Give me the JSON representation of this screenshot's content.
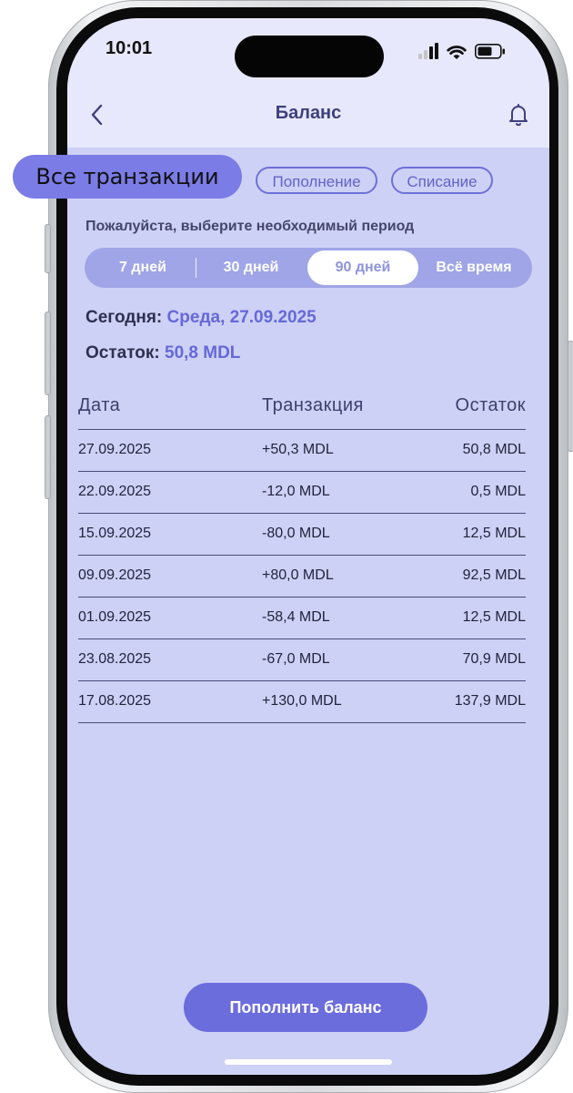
{
  "status_bar": {
    "time": "10:01"
  },
  "header": {
    "title": "Баланс"
  },
  "tooltip": {
    "label": "Все транзакции"
  },
  "filters": {
    "topup": "Пополнение",
    "debit": "Списание"
  },
  "period": {
    "prompt": "Пожалуйста, выберите необходимый период",
    "options": [
      "7 дней",
      "30 дней",
      "90 дней",
      "Всё время"
    ],
    "selected": "90 дней"
  },
  "summary": {
    "today_label": "Сегодня:",
    "today_value": "Среда, 27.09.2025",
    "balance_label": "Остаток:",
    "balance_value": "50,8 MDL"
  },
  "table": {
    "headers": [
      "Дата",
      "Транзакция",
      "Остаток"
    ],
    "rows": [
      [
        "27.09.2025",
        "+50,3 MDL",
        "50,8 MDL"
      ],
      [
        "22.09.2025",
        "-12,0 MDL",
        "0,5 MDL"
      ],
      [
        "15.09.2025",
        "-80,0 MDL",
        "12,5 MDL"
      ],
      [
        "09.09.2025",
        "+80,0 MDL",
        "92,5 MDL"
      ],
      [
        "01.09.2025",
        "-58,4 MDL",
        "12,5 MDL"
      ],
      [
        "23.08.2025",
        "-67,0 MDL",
        "70,9 MDL"
      ],
      [
        "17.08.2025",
        "+130,0 MDL",
        "137,9 MDL"
      ]
    ]
  },
  "cta": {
    "label": "Пополнить баланс"
  },
  "colors": {
    "accent": "#6c6ddc",
    "screen_bg": "#cdd1f5",
    "header_bg": "#e7e8fc",
    "segmented_bg": "#9fa5e6"
  }
}
